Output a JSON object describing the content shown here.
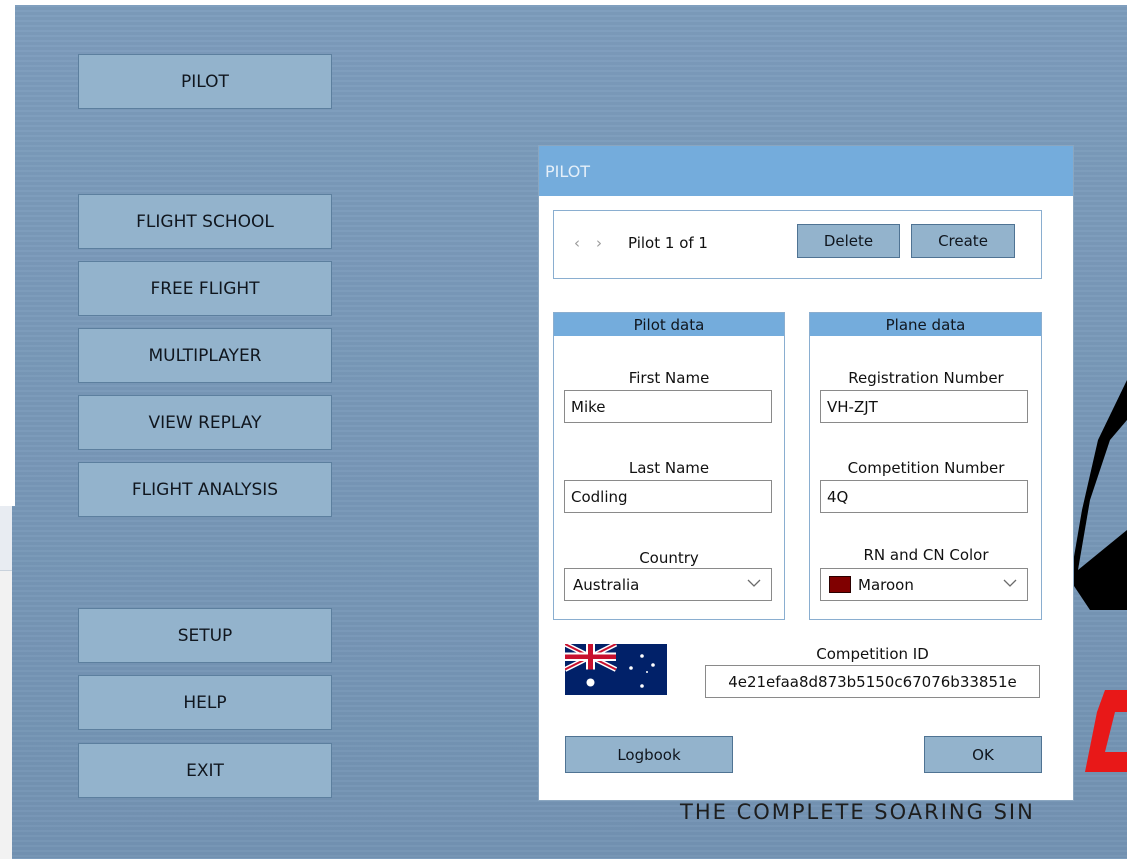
{
  "menu": {
    "pilot": "PILOT",
    "flight_school": "FLIGHT SCHOOL",
    "free_flight": "FREE FLIGHT",
    "multiplayer": "MULTIPLAYER",
    "view_replay": "VIEW REPLAY",
    "flight_analysis": "FLIGHT ANALYSIS",
    "setup": "SETUP",
    "help": "HELP",
    "exit": "EXIT"
  },
  "branding": {
    "tagline": "THE COMPLETE SOARING SIN",
    "logo_color": "#e81818"
  },
  "dialog": {
    "title": "PILOT",
    "nav": {
      "prev_icon": "chevron-left-icon",
      "next_icon": "chevron-right-icon",
      "position_text": "Pilot 1 of 1",
      "delete_label": "Delete",
      "create_label": "Create"
    },
    "pilot_data": {
      "heading": "Pilot data",
      "first_name_label": "First Name",
      "first_name": "Mike",
      "last_name_label": "Last Name",
      "last_name": "Codling",
      "country_label": "Country",
      "country": "Australia"
    },
    "plane_data": {
      "heading": "Plane data",
      "registration_label": "Registration Number",
      "registration": "VH-ZJT",
      "competition_label": "Competition Number",
      "competition": "4Q",
      "color_label": "RN and CN Color",
      "color": "Maroon",
      "color_hex": "#800000"
    },
    "competition_id_label": "Competition ID",
    "competition_id": "4e21efaa8d873b5150c67076b33851e",
    "flag_icon": "australia-flag-icon",
    "logbook_label": "Logbook",
    "ok_label": "OK"
  },
  "colors": {
    "title_bar": "#74acdc",
    "button": "#93b3cc",
    "background": "#7797b7"
  }
}
